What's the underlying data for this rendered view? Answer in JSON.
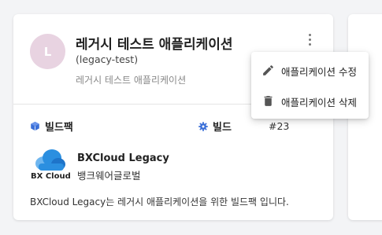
{
  "app": {
    "avatar_letter": "L",
    "title": "레거시 테스트 애플리케이션",
    "slug": "(legacy-test)",
    "description": "레거시 테스트 애플리케이션"
  },
  "buildpack": {
    "section_label": "빌드팩",
    "logo_text": "BX Cloud",
    "name": "BXCloud Legacy",
    "org": "뱅크웨어글로벌"
  },
  "build": {
    "section_label": "빌드",
    "number": "#23"
  },
  "card_description": "BXCloud Legacy는 레거시 애플리케이션을 위한 빌드팩 입니다.",
  "menu": {
    "items": [
      {
        "label": "애플리케이션 수정",
        "icon": "pencil-icon"
      },
      {
        "label": "애플리케이션 삭제",
        "icon": "trash-icon"
      }
    ]
  },
  "colors": {
    "avatar_bg": "#e8d3e1",
    "accent_blue": "#3a6fd8",
    "logo_blue": "#2b8fe0"
  }
}
